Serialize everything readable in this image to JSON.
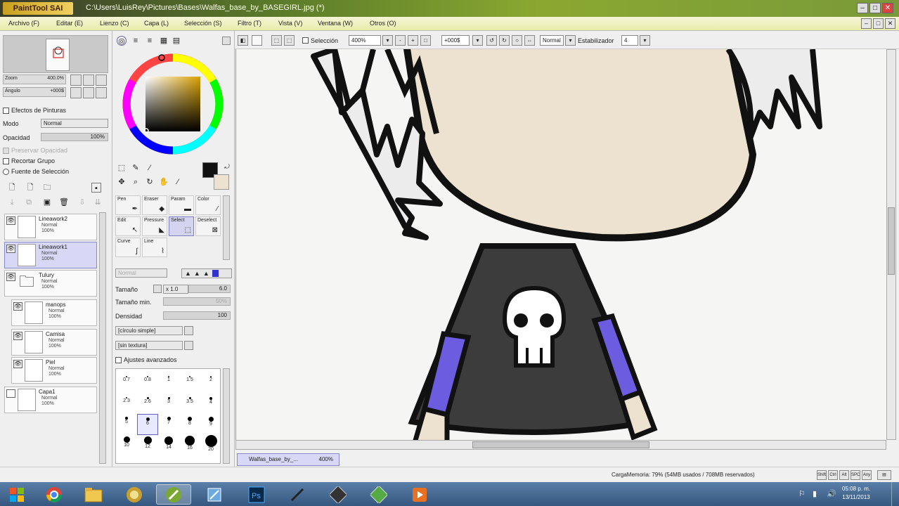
{
  "window": {
    "app_logo": "PaintTool SAI",
    "title_path": "C:\\Users\\LuisRey\\Pictures\\Bases\\Walfas_base_by_BASEGIRL.jpg (*)"
  },
  "menu": {
    "items": [
      "Archivo (F)",
      "Editar (E)",
      "Lienzo (C)",
      "Capa (L)",
      "Selección (S)",
      "Filtro (T)",
      "Vista (V)",
      "Ventana (W)",
      "Otros (O)"
    ]
  },
  "navigator": {
    "zoom_label": "Zoom",
    "zoom_value": "400.0%",
    "angle_label": "Ángulo",
    "angle_value": "+000$"
  },
  "layer_panel": {
    "effects_label": "Efectos de Pinturas",
    "mode_label": "Modo",
    "mode_value": "Normal",
    "opacity_label": "Opacidad",
    "opacity_value": "100%",
    "preserve_opacity": "Preservar Opacidad",
    "clip_group": "Recortar Grupo",
    "selection_source": "Fuente de Selección",
    "layers": [
      {
        "name": "Lineawork2",
        "mode": "Normal",
        "opacity": "100%"
      },
      {
        "name": "Lineawork1",
        "mode": "Normal",
        "opacity": "100%"
      },
      {
        "name": "Tulury",
        "mode": "Normal",
        "opacity": "100%"
      },
      {
        "name": "manops",
        "mode": "Normal",
        "opacity": "100%"
      },
      {
        "name": "Camisa",
        "mode": "Normal",
        "opacity": "100%"
      },
      {
        "name": "Piel",
        "mode": "Normal",
        "opacity": "100%"
      },
      {
        "name": "Capa1",
        "mode": "Normal",
        "opacity": "100%"
      }
    ]
  },
  "colors": {
    "primary": "#111111",
    "accent": "#d8d8f6",
    "shirt": "#3c3c3c",
    "sleeve": "#6b5ce0",
    "skin": "#ece2cf"
  },
  "tools": {
    "cells": [
      {
        "label": "Pen",
        "icon": "pen-icon"
      },
      {
        "label": "Eraser",
        "icon": "eraser-icon"
      },
      {
        "label": "Param",
        "icon": "bucket-icon"
      },
      {
        "label": "Color",
        "icon": "color-icon"
      },
      {
        "label": "Edit",
        "icon": "edit-icon"
      },
      {
        "label": "Pressure",
        "icon": "pressure-icon"
      },
      {
        "label": "Select",
        "icon": "select-icon"
      },
      {
        "label": "Deselect",
        "icon": "deselect-icon"
      },
      {
        "label": "Curve",
        "icon": "curve-icon"
      },
      {
        "label": "Line",
        "icon": "line-icon"
      }
    ]
  },
  "brush": {
    "mode_value": "Normal",
    "size_label": "Tamaño",
    "size_mult": "x 1.0",
    "size_value": "6.0",
    "min_size_label": "Tamaño min.",
    "min_size_value": "50%",
    "density_label": "Densidad",
    "density_value": "100",
    "shape_value": "[círculo simple]",
    "texture_value": "[sin textura]",
    "advanced_label": "Ajustes avanzados",
    "sizes": [
      "0.7",
      "0.8",
      "1",
      "1.5",
      "2",
      "2.3",
      "2.6",
      "3",
      "3.5",
      "4",
      "5",
      "6",
      "7",
      "8",
      "9",
      "10",
      "12",
      "14",
      "16",
      "20"
    ]
  },
  "canvas_toolbar": {
    "selection_label": "Selección",
    "zoom_value": "400%",
    "angle_value": "+000$",
    "blend_value": "Normal",
    "stabilizer_label": "Estabilizador",
    "stabilizer_value": "4"
  },
  "document_tab": {
    "name": "Walfas_base_by_...",
    "zoom": "400%"
  },
  "status": {
    "memory": "CargaMemoria: 79% (54MB usados / 708MB reservados)",
    "buttons": [
      "Shift",
      "Ctrl",
      "Alt",
      "SPC",
      "Any"
    ]
  },
  "taskbar": {
    "time": "05:08 p. m.",
    "date": "13/11/2013",
    "apps": [
      "start-icon",
      "chrome-icon",
      "folder-icon",
      "winamp-icon",
      "sai-icon",
      "ie-icon",
      "photoshop-icon",
      "pen-tool-icon",
      "flash-icon",
      "game-icon",
      "media-icon"
    ]
  }
}
